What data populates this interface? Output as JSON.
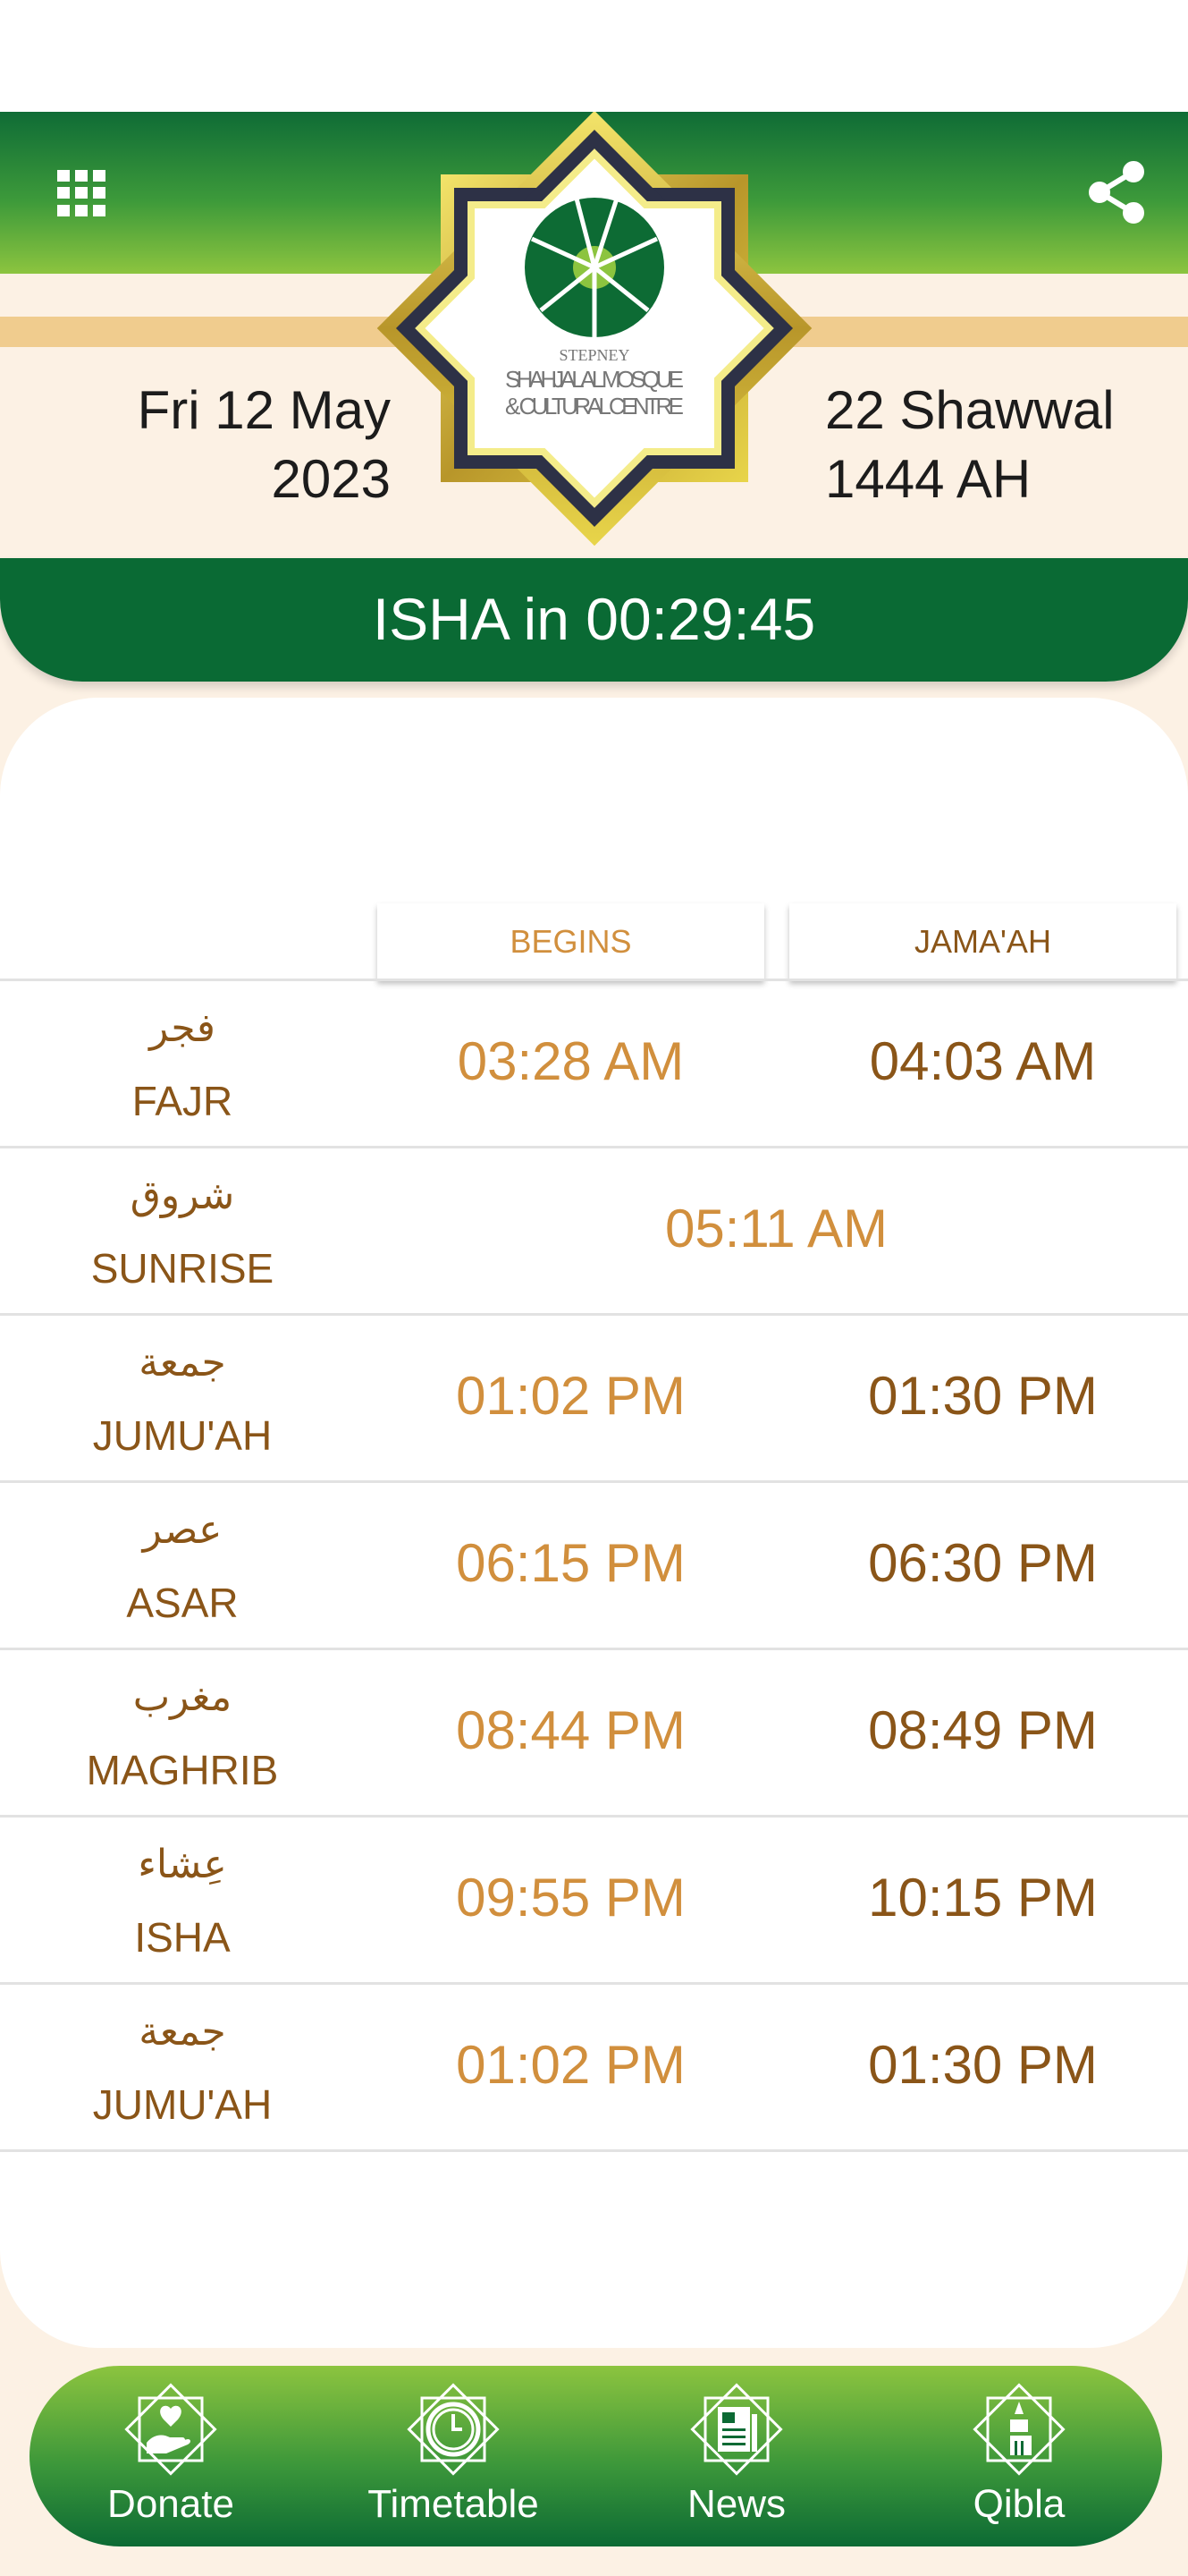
{
  "header": {
    "menu_icon": "grid-icon",
    "share_icon": "share-icon",
    "gregorian_line1": "Fri 12 May",
    "gregorian_line2": "2023",
    "hijri_line1": "22 Shawwal",
    "hijri_line2": "1444 AH",
    "logo": {
      "line1": "STEPNEY",
      "line2": "SHAHJALAL MOSQUE",
      "line3": "& CULTURAL CENTRE"
    }
  },
  "countdown": "ISHA in 00:29:45",
  "table": {
    "col_begins": "BEGINS",
    "col_jamaah": "JAMA'AH",
    "rows": [
      {
        "arabic": "فجر",
        "name": "FAJR",
        "begins": "03:28 AM",
        "jamaah": "04:03 AM"
      },
      {
        "arabic": "شروق",
        "name": "SUNRISE",
        "begins": "05:11 AM",
        "jamaah": ""
      },
      {
        "arabic": "جمعة",
        "name": "JUMU'AH",
        "begins": "01:02 PM",
        "jamaah": "01:30 PM"
      },
      {
        "arabic": "عصر",
        "name": "ASAR",
        "begins": "06:15 PM",
        "jamaah": "06:30 PM"
      },
      {
        "arabic": "مغرب",
        "name": "MAGHRIB",
        "begins": "08:44 PM",
        "jamaah": "08:49 PM"
      },
      {
        "arabic": "عِشاء",
        "name": "ISHA",
        "begins": "09:55 PM",
        "jamaah": "10:15 PM"
      },
      {
        "arabic": "جمعة",
        "name": "JUMU'AH",
        "begins": "01:02 PM",
        "jamaah": "01:30 PM"
      }
    ]
  },
  "nav": [
    {
      "label": "Donate",
      "icon": "donate-hand-heart-icon"
    },
    {
      "label": "Timetable",
      "icon": "clock-icon"
    },
    {
      "label": "News",
      "icon": "newspaper-icon"
    },
    {
      "label": "Qibla",
      "icon": "qibla-mosque-icon"
    }
  ],
  "colors": {
    "green_dark": "#0a6a34",
    "green_light": "#8cc43f",
    "begins": "#d18f3d",
    "jamaah": "#8a5518",
    "cream": "#fcf1e4"
  }
}
